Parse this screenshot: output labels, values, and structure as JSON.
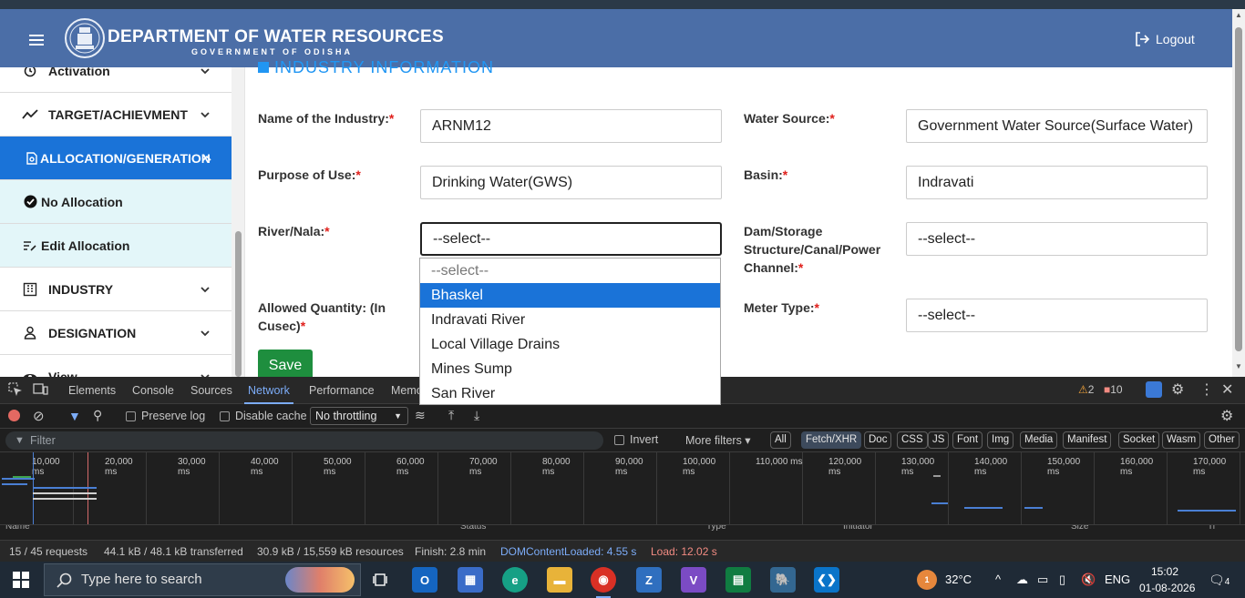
{
  "header": {
    "title": "DEPARTMENT OF WATER RESOURCES",
    "subtitle": "GOVERNMENT OF ODISHA",
    "logout_label": "Logout"
  },
  "sidebar": {
    "items": [
      {
        "label": "Activation"
      },
      {
        "label": "TARGET/ACHIEVMENT"
      },
      {
        "label": "ALLOCATION/GENERATION"
      },
      {
        "label": "No Allocation"
      },
      {
        "label": "Edit Allocation"
      },
      {
        "label": "INDUSTRY"
      },
      {
        "label": "DESIGNATION"
      },
      {
        "label": "View"
      }
    ]
  },
  "form": {
    "section_title": "INDUSTRY INFORMATION",
    "industry_name_label": "Name of the Industry:",
    "industry_name_value": "ARNM12",
    "water_source_label": "Water Source:",
    "water_source_value": "Government Water Source(Surface Water)",
    "purpose_label": "Purpose of Use:",
    "purpose_value": "Drinking Water(GWS)",
    "basin_label": "Basin:",
    "basin_value": "Indravati",
    "river_label": "River/Nala:",
    "river_value": "--select--",
    "dam_label": "Dam/Storage Structure/Canal/Power Channel:",
    "dam_value": "--select--",
    "quantity_label": "Allowed Quantity: (In Cusec)",
    "meter_label": "Meter Type:",
    "meter_value": "--select--",
    "required_mark": "*",
    "save_label": "Save"
  },
  "dropdown": {
    "options": [
      "--select--",
      "Bhaskel",
      "Indravati River",
      "Local Village Drains",
      "Mines Sump",
      "San River"
    ],
    "selected": "Bhaskel"
  },
  "devtools": {
    "tabs": [
      "Elements",
      "Console",
      "Sources",
      "Network",
      "Performance",
      "Memo"
    ],
    "active_tab": "Network",
    "warnings": "2",
    "errors": "10",
    "preserve_log": "Preserve log",
    "disable_cache": "Disable cache",
    "throttling": "No throttling",
    "filter_placeholder": "Filter",
    "invert": "Invert",
    "more_filters": "More filters",
    "chips": [
      "All",
      "Fetch/XHR",
      "Doc",
      "CSS",
      "JS",
      "Font",
      "Img",
      "Media",
      "Manifest",
      "Socket",
      "Wasm",
      "Other"
    ],
    "active_chip": "Fetch/XHR",
    "ticks": [
      "10,000 ms",
      "20,000 ms",
      "30,000 ms",
      "40,000 ms",
      "50,000 ms",
      "60,000 ms",
      "70,000 ms",
      "80,000 ms",
      "90,000 ms",
      "100,000 ms",
      "110,000 ms",
      "120,000 ms",
      "130,000 ms",
      "140,000 ms",
      "150,000 ms",
      "160,000 ms",
      "170,000 ms"
    ],
    "columns": [
      "Name",
      "Status",
      "Type",
      "Initiator",
      "Size",
      "Ti"
    ],
    "requests": "15 / 45 requests",
    "transferred": "44.1 kB / 48.1 kB transferred",
    "resources": "30.9 kB / 15,559 kB resources",
    "finish": "Finish: 2.8 min",
    "dom_loaded": "DOMContentLoaded: 4.55 s",
    "load": "Load: 12.02 s"
  },
  "taskbar": {
    "search_placeholder": "Type here to search",
    "weather": "32°C",
    "language": "ENG",
    "time": "15:02",
    "date": "01-08-2026",
    "notifications": "4",
    "badge": "1"
  },
  "colors": {
    "header_bg": "#4b6ea7",
    "accent": "#1a73d8",
    "save_green": "#1e8e3e",
    "required_red": "#e0201c"
  }
}
